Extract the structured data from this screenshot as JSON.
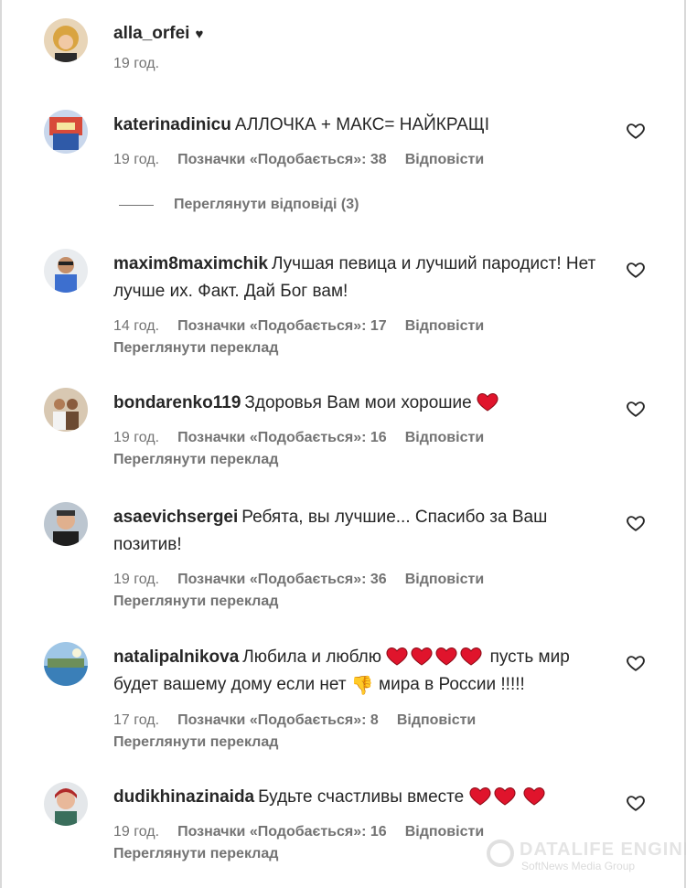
{
  "post": {
    "author": "alla_orfei",
    "heart_mark": "♥",
    "time": "19 год."
  },
  "view_replies": "Переглянути відповіді (3)",
  "comments": [
    {
      "username": "katerinadinicu",
      "text": "АЛЛОЧКА + МАКС= НАЙКРАЩІ",
      "time": "19 год.",
      "likes": "Позначки «Подобається»: 38",
      "reply": "Відповісти"
    },
    {
      "username": "maxim8maximchik",
      "text": "Лучшая певица и лучший пародист! Нет лучше их. Факт. Дай Бог вам!",
      "time": "14 год.",
      "likes": "Позначки «Подобається»: 17",
      "reply": "Відповісти",
      "translate": "Переглянути переклад"
    },
    {
      "username": "bondarenko119",
      "text": "Здоровья Вам мои хорошие",
      "time": "19 год.",
      "likes": "Позначки «Подобається»: 16",
      "reply": "Відповісти",
      "translate": "Переглянути переклад"
    },
    {
      "username": "asaevichsergei",
      "text": "Ребята, вы лучшие... Спасибо за Ваш позитив!",
      "time": "19 год.",
      "likes": "Позначки «Подобається»: 36",
      "reply": "Відповісти",
      "translate": "Переглянути переклад"
    },
    {
      "username": "natalipalnikova",
      "text_a": "Любила и люблю",
      "text_b": "пусть мир будет вашему дому если нет",
      "text_c": "мира в России !!!!!",
      "thumb": "👎",
      "time": "17 год.",
      "likes": "Позначки «Подобається»: 8",
      "reply": "Відповісти",
      "translate": "Переглянути переклад"
    },
    {
      "username": "dudikhinazinaida",
      "text": "Будьте счастливы вместе",
      "time": "19 год.",
      "likes": "Позначки «Подобається»: 16",
      "reply": "Відповісти",
      "translate": "Переглянути переклад"
    }
  ],
  "watermark": {
    "title": "DATALIFE ENGINE",
    "subtitle": "SoftNews Media Group"
  },
  "colors": {
    "text": "#262626",
    "secondary": "#737373",
    "emoji_heart": "#e0142c"
  }
}
